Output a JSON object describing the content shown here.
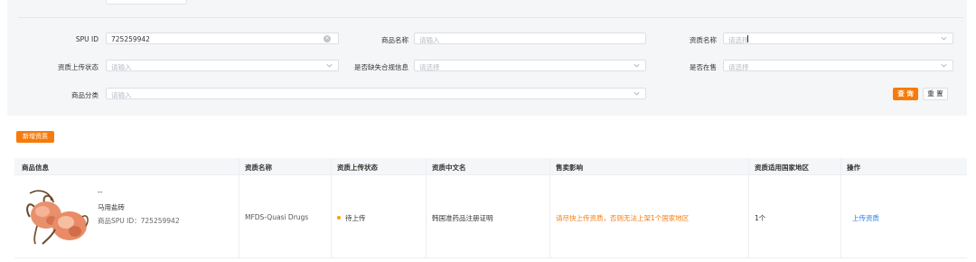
{
  "filters": {
    "spu_id": {
      "label": "SPU ID",
      "value": "725259942"
    },
    "product_name": {
      "label": "商品名称",
      "placeholder": "请输入"
    },
    "qualification_name": {
      "label": "资质名称",
      "placeholder": "请选择"
    },
    "upload_status": {
      "label": "资质上传状态",
      "placeholder": "请输入"
    },
    "missing_compliance": {
      "label": "是否缺失合规信息",
      "placeholder": "请选择"
    },
    "on_sale": {
      "label": "是否在售",
      "placeholder": "请选择"
    },
    "category": {
      "label": "商品分类",
      "placeholder": "请输入"
    }
  },
  "buttons": {
    "search": "查 询",
    "reset": "重 置",
    "add": "新增资质"
  },
  "table": {
    "headers": [
      "商品信息",
      "资质名称",
      "资质上传状态",
      "资质中文名",
      "售卖影响",
      "资质适用国家地区",
      "操作"
    ],
    "rows": [
      {
        "dash": "--",
        "product_name": "马用盐砖",
        "spu_line": "商品SPU ID：725259942",
        "qualification_name": "MFDS-Quasi Drugs",
        "status": "待上传",
        "cn_name": "韩国准药品注册证明",
        "impact": "请尽快上传资质，否则无法上架1个国家地区",
        "countries": "1个",
        "action": "上传资质"
      }
    ]
  },
  "colors": {
    "accent": "#f77b0c",
    "status_dot": "#f7a20c",
    "link": "#2a7de1"
  }
}
